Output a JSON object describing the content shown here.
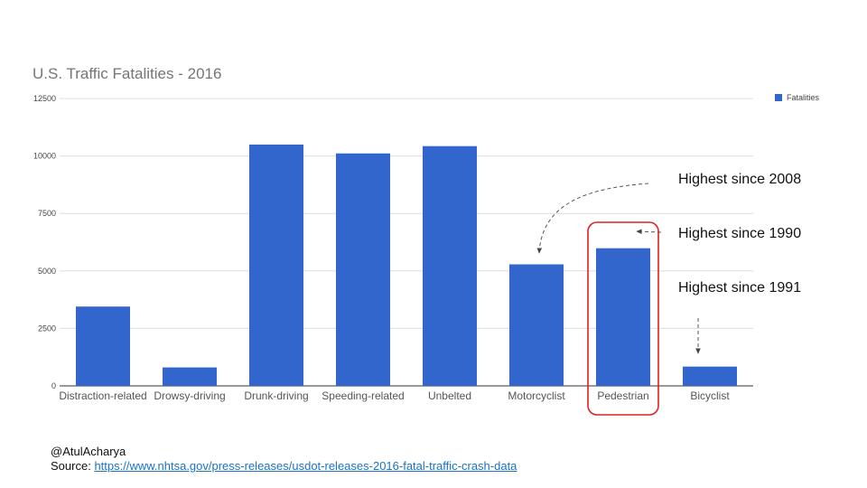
{
  "chart_data": {
    "type": "bar",
    "title": "U.S. Traffic Fatalities - 2016",
    "categories": [
      "Distraction-related",
      "Drowsy-driving",
      "Drunk-driving",
      "Speeding-related",
      "Unbelted",
      "Motorcyclist",
      "Pedestrian",
      "Bicyclist"
    ],
    "series": [
      {
        "name": "Fatalities",
        "values": [
          3450,
          803,
          10497,
          10111,
          10428,
          5286,
          5987,
          840
        ]
      }
    ],
    "ylim": [
      0,
      12500
    ],
    "yticks": [
      0,
      2500,
      5000,
      7500,
      10000,
      12500
    ],
    "grid": true,
    "legend": "right",
    "bar_color": "#3366cc",
    "annotations": [
      {
        "text": "Highest since 2008",
        "target": "Motorcyclist"
      },
      {
        "text": "Highest since 1990",
        "target": "Pedestrian"
      },
      {
        "text": "Highest since 1991",
        "target": "Bicyclist"
      }
    ],
    "highlight": {
      "category": "Pedestrian",
      "color": "#e02020"
    }
  },
  "footer": {
    "author": "@AtulAcharya",
    "source_label": "Source:",
    "source_url": "https://www.nhtsa.gov/press-releases/usdot-releases-2016-fatal-traffic-crash-data"
  }
}
